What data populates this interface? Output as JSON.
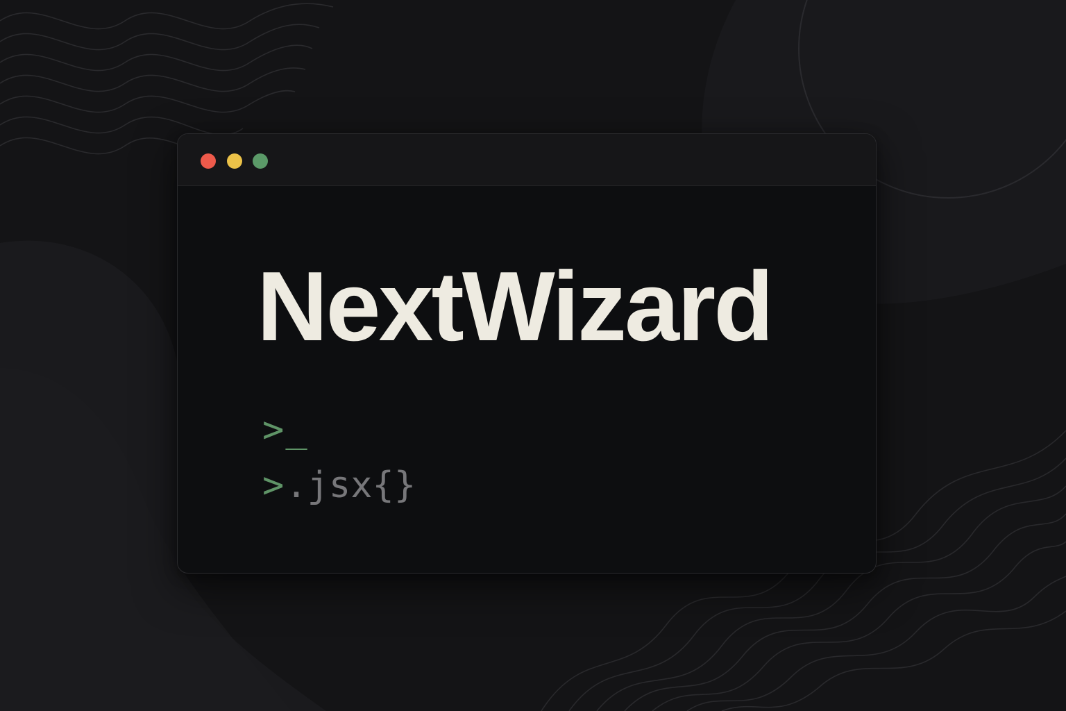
{
  "window": {
    "traffic_lights": [
      {
        "name": "close",
        "color": "#ee5a4b"
      },
      {
        "name": "minimize",
        "color": "#ecc248"
      },
      {
        "name": "maximize",
        "color": "#5b9a68"
      }
    ]
  },
  "content": {
    "title": "NextWizard",
    "prompt_1": {
      "symbol": ">",
      "cursor": "_"
    },
    "prompt_2": {
      "symbol": ">",
      "text": ".jsx{}"
    }
  },
  "colors": {
    "background": "#141416",
    "window": "#0d0e10",
    "titlebar": "#161618",
    "title_text": "#eeebe1",
    "prompt_green": "#5f9467",
    "code_gray": "#77777a"
  }
}
